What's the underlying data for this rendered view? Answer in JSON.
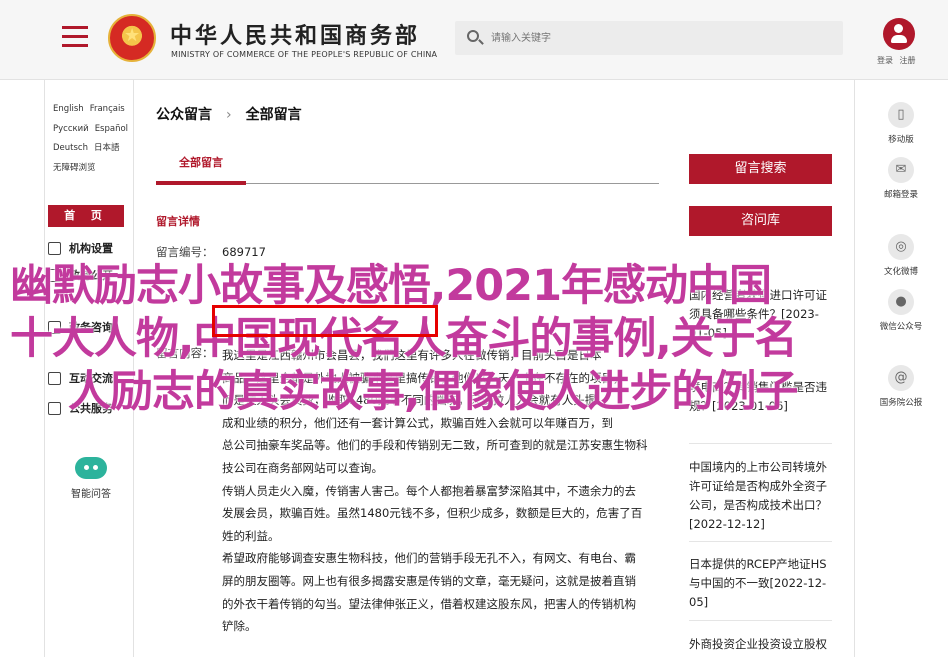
{
  "header": {
    "title_cn": "中华人民共和国商务部",
    "title_en": "MINISTRY OF COMMERCE OF THE PEOPLE'S REPUBLIC OF CHINA",
    "search_placeholder": "请输入关键字",
    "login": "登录",
    "register": "注册"
  },
  "left_sidebar": {
    "languages": [
      [
        "English",
        "Français"
      ],
      [
        "Русский",
        "Español"
      ],
      [
        "Deutsch",
        "日本語"
      ],
      [
        "无障碍浏览"
      ]
    ],
    "home": "首 页",
    "nav": [
      "机构设置",
      "政务公开",
      "政务咨询",
      "互动交流",
      "公共服务"
    ],
    "smart_qa": "智能问答"
  },
  "main": {
    "breadcrumb": [
      "公众留言",
      "全部留言"
    ],
    "tab": "全部留言",
    "detail_title": "留言详情",
    "msg_id_label": "留言编号：",
    "msg_id": "689717",
    "content_label": "留言内容：",
    "paragraphs": [
      "我这里是江西赣州市会昌县，我们这里有许多人在做传销，目前头目是日本",
      "商品，这里全都是外地人被骗来这里搞传销，他们以一天一个在不存在的项目，",
      "而是拉人头会员费，收取1480元等不同的档次，只要拉人入会就有人头提",
      "成和业绩的积分，他们还有一套计算公式，欺骗百姓入会就可以年赚百万，到",
      "总公司抽豪车奖品等。他们的手段和传销别无二致，所可查到的就是江苏安惠生物科",
      "技公司在商务部网站可以查询。",
      "传销人员走火入魔，传销害人害己。每个人都抱着暴富梦深陷其中，不遗余力的去",
      "发展会员，欺骗百姓。虽然1480元钱不多，但积少成多，数额是巨大的，危害了百",
      "姓的利益。",
      "希望政府能够调查安惠生物科技，他们的营销手段无孔不入，有网文、有电台、霸",
      "屏的朋友圈等。网上也有很多揭露安惠是传销的文章，毫无疑问，这就是披着直销",
      "的外衣干着传销的勾当。望法律伸张正义，借着权建这股东风，把害人的传销机构",
      "铲除。"
    ]
  },
  "right_column": {
    "btn_message": "留言搜索",
    "btn_faq": "咨问库",
    "related": [
      "国内经营者获得进口许可证须具备哪些条件？[2023-01-05]",
      "境电商？其销售门槛是否违规？[2023-01-06]",
      "中国境内的上市公司转境外许可证给是否构成外全资子公司，是否构成技术出口？[2022-12-12]",
      "日本提供的RCEP产地证HS与中国的不一致[2022-12-05]",
      "外商投资企业投资设立股权变"
    ]
  },
  "right_sidebar": {
    "items": [
      "移动版",
      "邮箱登录",
      "文化微博",
      "微信公众号",
      "国务院公报"
    ]
  },
  "overlay": {
    "line1": "幽默励志小故事及感悟,2021年感动中国",
    "line2": "十大人物,中国现代名人奋斗的事例,关于名",
    "line3": "人励志的真实故事,偶像使人进步的例子"
  }
}
